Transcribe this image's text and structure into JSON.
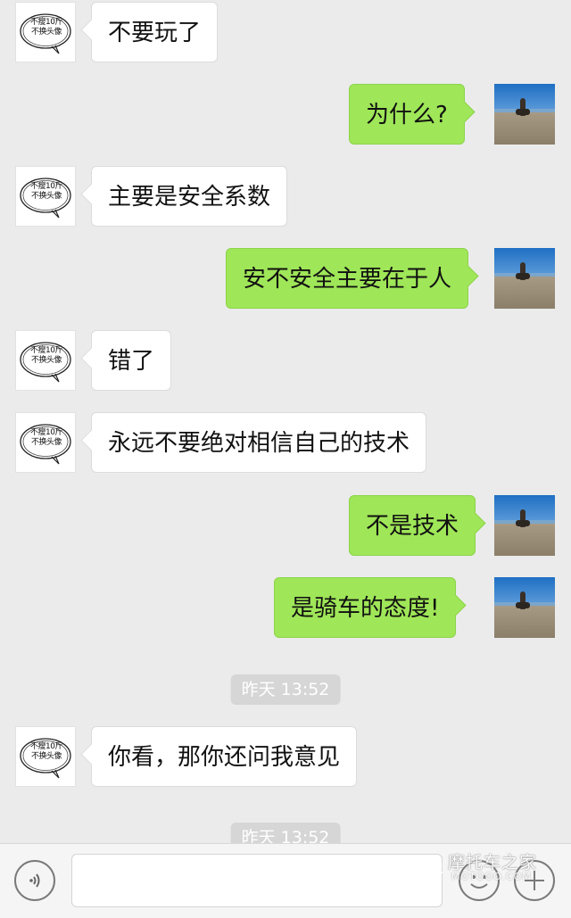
{
  "avatar_caption": {
    "line1": "不瘦10斤",
    "line2": "不换头像"
  },
  "messages": [
    {
      "side": "left",
      "text": "不要玩了"
    },
    {
      "side": "right",
      "text": "为什么?"
    },
    {
      "side": "left",
      "text": "主要是安全系数"
    },
    {
      "side": "right",
      "text": "安不安全主要在于人"
    },
    {
      "side": "left",
      "text": "错了"
    },
    {
      "side": "left",
      "text": "永远不要绝对相信自己的技术"
    },
    {
      "side": "right",
      "text": "不是技术"
    },
    {
      "side": "right",
      "text": "是骑车的态度!"
    },
    {
      "side": "left",
      "text": "你看，那你还问我意见"
    }
  ],
  "timestamps": [
    "昨天 13:52",
    "昨天 13:52"
  ],
  "input_bar": {
    "voice_icon": "voice-icon",
    "emoji_icon": "emoji-icon",
    "plus_icon": "plus-icon",
    "input_value": ""
  },
  "watermark": {
    "text": "摩托车之家",
    "sub": "MOTOOO.COM"
  },
  "colors": {
    "sent_bubble": "#9fe658",
    "received_bubble": "#ffffff",
    "background": "#ebebeb"
  }
}
